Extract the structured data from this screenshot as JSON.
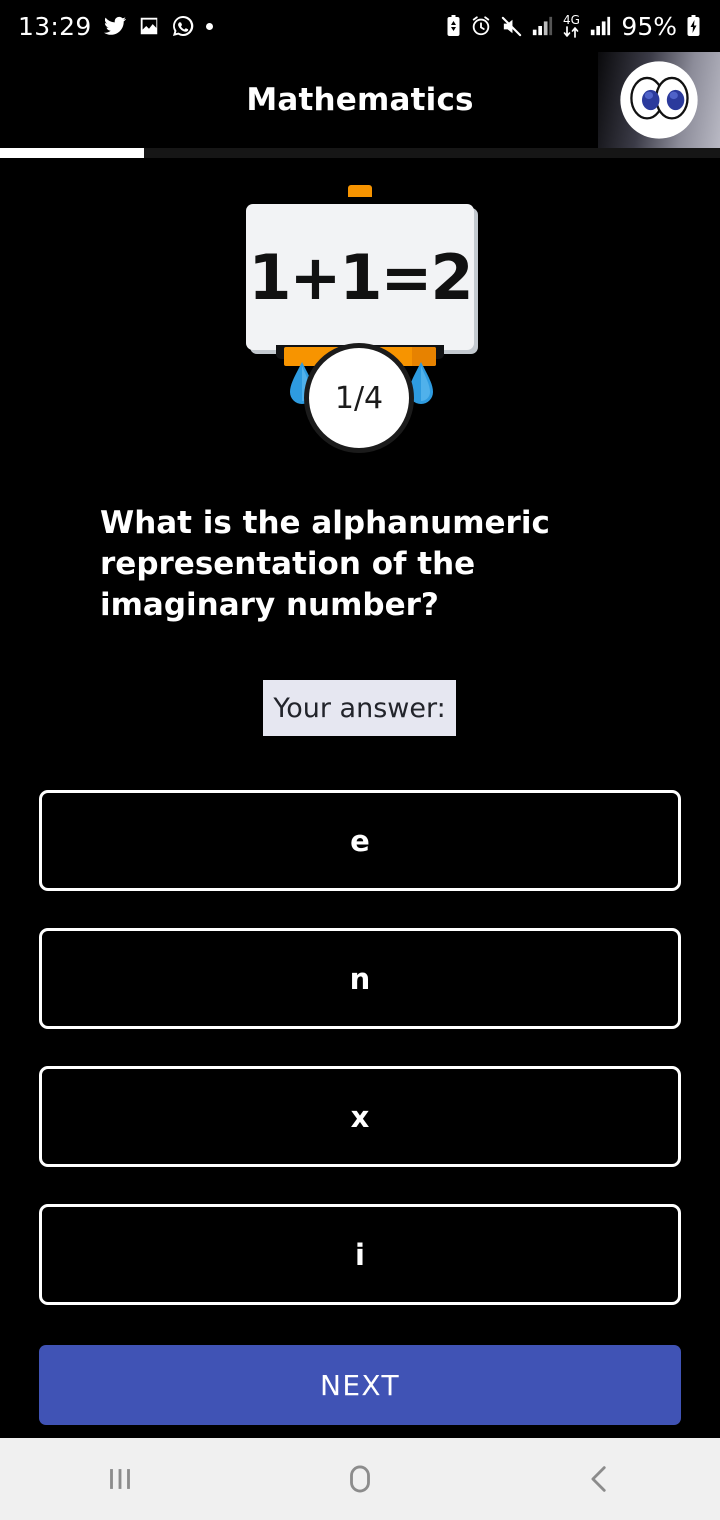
{
  "status_bar": {
    "clock": "13:29",
    "battery_percent": "95%",
    "network_label": "4G",
    "left_icons": [
      "twitter-icon",
      "image-icon",
      "whatsapp-icon",
      "dot-indicator-icon"
    ],
    "right_icons": [
      "battery-saver-icon",
      "alarm-icon",
      "mute-icon",
      "signal-bars-icon",
      "mobile-data-icon",
      "signal-bars-2-icon",
      "battery-charging-icon"
    ]
  },
  "header": {
    "title": "Mathematics",
    "avatar_icon": "eyes-emoji-avatar"
  },
  "progress": {
    "percent": 20
  },
  "illustration": {
    "board_equation": "1+1=2",
    "badge_label": "1/4",
    "colors": {
      "board": "#F2F3F5",
      "tray": "#F79400",
      "drop": "#2E9BE0"
    }
  },
  "question": {
    "text": "What is the alphanumeric representation of the imaginary number?"
  },
  "answer_prompt": {
    "label": "Your answer:"
  },
  "options": [
    {
      "label": "e"
    },
    {
      "label": "n"
    },
    {
      "label": "x"
    },
    {
      "label": "i"
    }
  ],
  "next_button": {
    "label": "NEXT",
    "color": "#4053B5"
  },
  "nav_bar": {
    "items": [
      {
        "icon": "recents-icon"
      },
      {
        "icon": "home-icon"
      },
      {
        "icon": "back-icon"
      }
    ]
  }
}
